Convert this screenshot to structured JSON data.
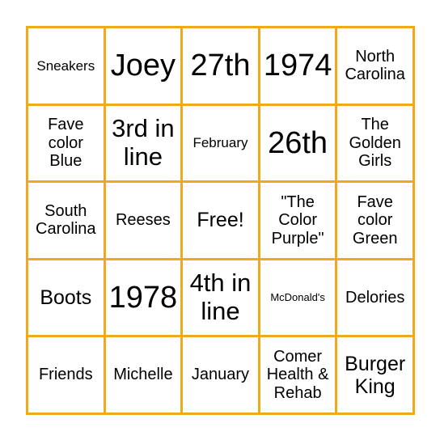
{
  "card": {
    "type": "bingo-card",
    "rows": 5,
    "columns": 5,
    "border_color": "#F0A81C",
    "cell_background": "#FFFFFF",
    "text_color": "#000000",
    "free_space_index": 12,
    "cells": [
      {
        "text": "Sneakers",
        "size": "sm"
      },
      {
        "text": "Joey",
        "size": "xxl"
      },
      {
        "text": "27th",
        "size": "xxl"
      },
      {
        "text": "1974",
        "size": "xxl"
      },
      {
        "text": "North\nCarolina",
        "size": "md"
      },
      {
        "text": "Fave\ncolor\nBlue",
        "size": "md"
      },
      {
        "text": "3rd in\nline",
        "size": "xl"
      },
      {
        "text": "February",
        "size": "sm"
      },
      {
        "text": "26th",
        "size": "xxl"
      },
      {
        "text": "The\nGolden\nGirls",
        "size": "md"
      },
      {
        "text": "South\nCarolina",
        "size": "md"
      },
      {
        "text": "Reeses",
        "size": "md"
      },
      {
        "text": "Free!",
        "size": "lg"
      },
      {
        "text": "\"The\nColor\nPurple\"",
        "size": "md"
      },
      {
        "text": "Fave\ncolor\nGreen",
        "size": "md"
      },
      {
        "text": "Boots",
        "size": "lg"
      },
      {
        "text": "1978",
        "size": "xxl"
      },
      {
        "text": "4th in\nline",
        "size": "xl"
      },
      {
        "text": "McDonald's",
        "size": "xs"
      },
      {
        "text": "Delories",
        "size": "md"
      },
      {
        "text": "Friends",
        "size": "md"
      },
      {
        "text": "Michelle",
        "size": "md"
      },
      {
        "text": "January",
        "size": "md"
      },
      {
        "text": "Comer\nHealth &\nRehab",
        "size": "md"
      },
      {
        "text": "Burger\nKing",
        "size": "lg"
      }
    ]
  }
}
